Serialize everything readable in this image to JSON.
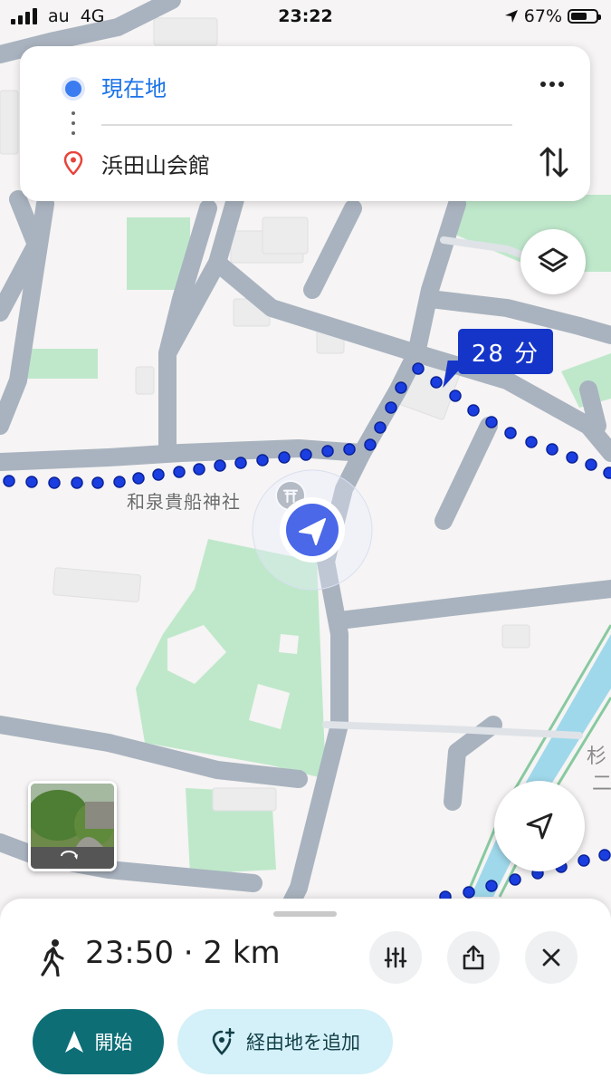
{
  "status_bar": {
    "carrier": "au",
    "network": "4G",
    "time": "23:22",
    "battery": "67%",
    "battery_level": 0.67
  },
  "route_card": {
    "origin": "現在地",
    "destination": "浜田山会館"
  },
  "map": {
    "eta_badge": "28 分",
    "shrine_label": "和泉貴船神社",
    "edge_label": "杉",
    "edge_label_2": "二"
  },
  "bottom_sheet": {
    "summary": "23:50 · 2 km",
    "start_label": "開始",
    "add_waypoint_label": "経由地を追加"
  },
  "colors": {
    "route": "#1a3ee0",
    "park": "#bfe8cb",
    "road": "#a9b3bf",
    "accent": "#0d6e76",
    "origin": "#1a73e8"
  },
  "icons": [
    "signal-icon",
    "location-arrow-icon",
    "battery-icon",
    "origin-dot-icon",
    "destination-pin-icon",
    "more-icon",
    "swap-icon",
    "layers-icon",
    "recenter-icon",
    "navigation-puck-icon",
    "shrine-icon",
    "walking-icon",
    "route-options-icon",
    "share-icon",
    "close-icon",
    "navigation-arrow-icon",
    "add-waypoint-icon"
  ]
}
